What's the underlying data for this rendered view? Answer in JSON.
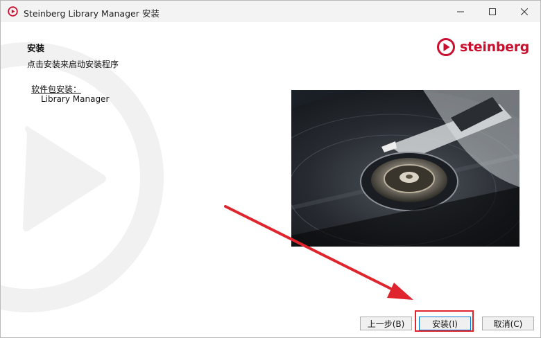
{
  "window": {
    "title": "Steinberg Library Manager 安装"
  },
  "brand": {
    "name": "steinberg",
    "color": "#c8102e"
  },
  "page": {
    "heading": "安装",
    "subheading": "点击安装来启动安装程序",
    "package_label": "软件包安装：",
    "packages": [
      "Library Manager"
    ]
  },
  "buttons": {
    "back": "上一步(B)",
    "install": "安装(I)",
    "cancel": "取消(C)"
  },
  "annotation_color": "#e0242e"
}
